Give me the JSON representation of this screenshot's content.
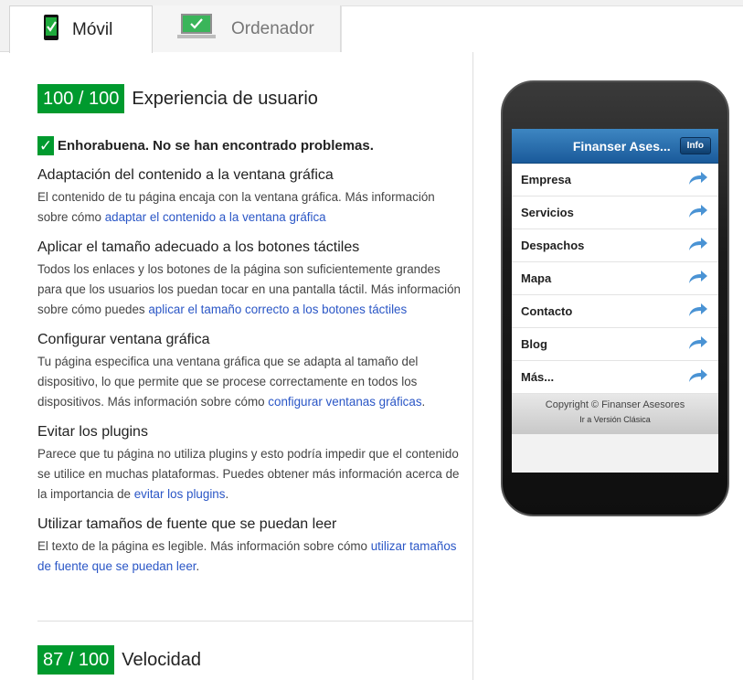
{
  "tabs": [
    {
      "label": "Móvil",
      "icon": "mobile-check-icon",
      "active": true
    },
    {
      "label": "Ordenador",
      "icon": "desktop-check-icon",
      "active": false
    }
  ],
  "ux": {
    "score": "100 / 100",
    "label": "Experiencia de usuario",
    "congrats": "Enhorabuena. No se han encontrado problemas.",
    "rules": [
      {
        "title": "Adaptación del contenido a la ventana gráfica",
        "text": "El contenido de tu página encaja con la ventana gráfica. Más información sobre cómo ",
        "link": "adaptar el contenido a la ventana gráfica",
        "after": ""
      },
      {
        "title": "Aplicar el tamaño adecuado a los botones táctiles",
        "text": "Todos los enlaces y los botones de la página son suficientemente grandes para que los usuarios los puedan tocar en una pantalla táctil. Más información sobre cómo puedes ",
        "link": "aplicar el tamaño correcto a los botones táctiles",
        "after": ""
      },
      {
        "title": "Configurar ventana gráfica",
        "text": "Tu página especifica una ventana gráfica que se adapta al tamaño del dispositivo, lo que permite que se procese correctamente en todos los dispositivos. Más información sobre cómo ",
        "link": "configurar ventanas gráficas",
        "after": "."
      },
      {
        "title": "Evitar los plugins",
        "text": "Parece que tu página no utiliza plugins y esto podría impedir que el contenido se utilice en muchas plataformas. Puedes obtener más información acerca de la importancia de ",
        "link": "evitar los plugins",
        "after": "."
      },
      {
        "title": "Utilizar tamaños de fuente que se puedan leer",
        "text": "El texto de la página es legible. Más información sobre cómo ",
        "link": "utilizar tamaños de fuente que se puedan leer",
        "after": "."
      }
    ]
  },
  "speed": {
    "score": "87 / 100",
    "label": "Velocidad"
  },
  "phone": {
    "app_title": "Finanser Ases...",
    "info_button": "Info",
    "menu": [
      "Empresa",
      "Servicios",
      "Despachos",
      "Mapa",
      "Contacto",
      "Blog",
      "Más..."
    ],
    "copyright": "Copyright © Finanser Asesores",
    "classic_link": "Ir a Versión Clásica"
  },
  "colors": {
    "score_green": "#009a2e",
    "link_blue": "#2a56c6",
    "app_header_blue": "#1a5a9a"
  }
}
